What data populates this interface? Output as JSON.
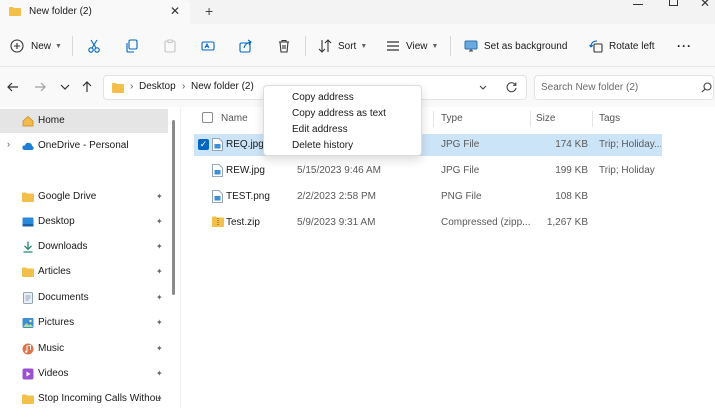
{
  "window": {
    "tab_title": "New folder (2)",
    "tab_close": "✕",
    "new_tab": "+"
  },
  "toolbar": {
    "new_label": "New",
    "sort_label": "Sort",
    "view_label": "View",
    "set_background_label": "Set as background",
    "rotate_left_label": "Rotate left",
    "more_label": "···"
  },
  "address": {
    "crumbs": [
      "Desktop",
      "New folder (2)"
    ],
    "separator": "›"
  },
  "search": {
    "placeholder": "Search New folder (2)"
  },
  "sidebar": {
    "items": [
      {
        "label": "Home",
        "icon": "home-icon",
        "selected": true
      },
      {
        "label": "OneDrive - Personal",
        "icon": "cloud-icon"
      },
      {
        "label": "Google Drive",
        "icon": "folder-icon",
        "pinned": true
      },
      {
        "label": "Desktop",
        "icon": "desktop-icon",
        "pinned": true
      },
      {
        "label": "Downloads",
        "icon": "download-icon",
        "pinned": true
      },
      {
        "label": "Articles",
        "icon": "folder-icon",
        "pinned": true
      },
      {
        "label": "Documents",
        "icon": "documents-icon",
        "pinned": true
      },
      {
        "label": "Pictures",
        "icon": "pictures-icon",
        "pinned": true
      },
      {
        "label": "Music",
        "icon": "music-icon",
        "pinned": true
      },
      {
        "label": "Videos",
        "icon": "videos-icon",
        "pinned": true
      },
      {
        "label": "Stop Incoming Calls Withou",
        "icon": "folder-icon",
        "pinned": true
      }
    ],
    "expander": "›",
    "pin_glyph": "📌"
  },
  "columns": {
    "name": "Name",
    "type": "Type",
    "size": "Size",
    "tags": "Tags"
  },
  "files": [
    {
      "name": "REQ.jpg",
      "date": "",
      "type": "JPG File",
      "size": "174 KB",
      "tags": "Trip; Holiday...",
      "selected": true,
      "kind": "image"
    },
    {
      "name": "REW.jpg",
      "date": "5/15/2023 9:46 AM",
      "type": "JPG File",
      "size": "199 KB",
      "tags": "Trip; Holiday",
      "kind": "image"
    },
    {
      "name": "TEST.png",
      "date": "2/2/2023 2:58 PM",
      "type": "PNG File",
      "size": "108 KB",
      "tags": "",
      "kind": "image"
    },
    {
      "name": "Test.zip",
      "date": "5/9/2023 9:31 AM",
      "type": "Compressed (zipp...",
      "size": "1,267 KB",
      "tags": "",
      "kind": "zip"
    }
  ],
  "context_menu": {
    "items": [
      "Copy address",
      "Copy address as text",
      "Edit address",
      "Delete history"
    ]
  },
  "colors": {
    "accent": "#0067c0",
    "selection": "#cce4f7",
    "folder": "#f2c04a"
  }
}
